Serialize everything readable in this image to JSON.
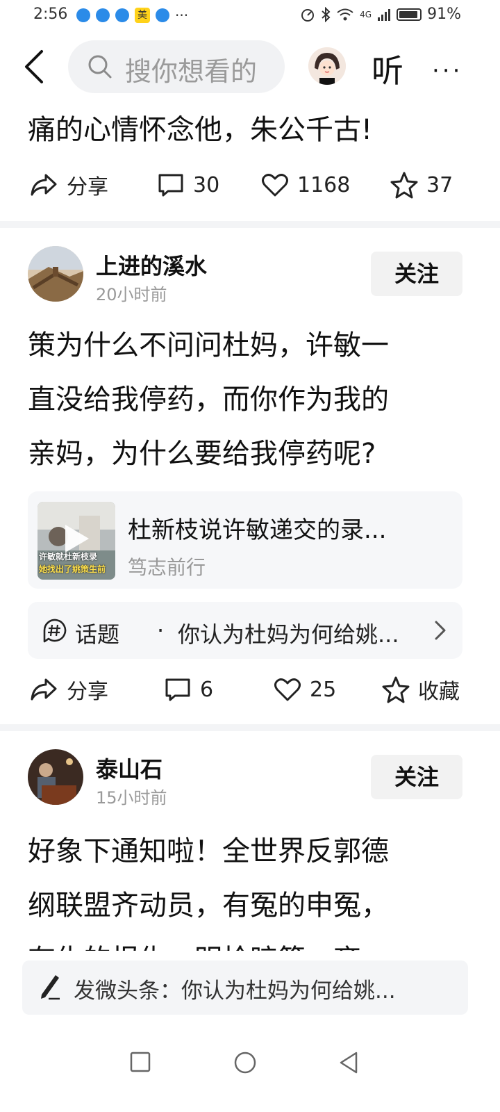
{
  "status_bar": {
    "time": "2:56",
    "app_badge": "美",
    "dots": "···",
    "network": "4G",
    "battery": "91%"
  },
  "header": {
    "search_placeholder": "搜你想看的",
    "listen_label": "听",
    "more_label": "···"
  },
  "post0": {
    "text_tail": "痛的心情怀念他，朱公千古!",
    "actions": {
      "share": "分享",
      "comments": "30",
      "likes": "1168",
      "favorites": "37"
    }
  },
  "post1": {
    "username": "上进的溪水",
    "time": "20小时前",
    "follow_label": "关注",
    "text_lines": [
      "策为什么不问问杜妈，许敏一",
      "直没给我停药，而你作为我的",
      "亲妈，为什么要给我停药呢?"
    ],
    "video_card": {
      "title": "杜新枝说许敏递交的录...",
      "source": "笃志前行",
      "thumb_caption_1": "许敏就杜新枝录",
      "thumb_caption_2": "她找出了姚策生前"
    },
    "topic": {
      "label": "话题",
      "sep": "·",
      "text": "你认为杜妈为何给姚..."
    },
    "actions": {
      "share": "分享",
      "comments": "6",
      "likes": "25",
      "favorite_label": "收藏"
    }
  },
  "post2": {
    "username": "泰山石",
    "time": "15小时前",
    "follow_label": "关注",
    "text_lines": [
      "好象下通知啦！全世界反郭德",
      "纲联盟齐动员，有冤的申冤，",
      "有仇的报仇，明枪暗箭，齐"
    ]
  },
  "compose_bar": {
    "text": "发微头条：你认为杜妈为何给姚..."
  }
}
